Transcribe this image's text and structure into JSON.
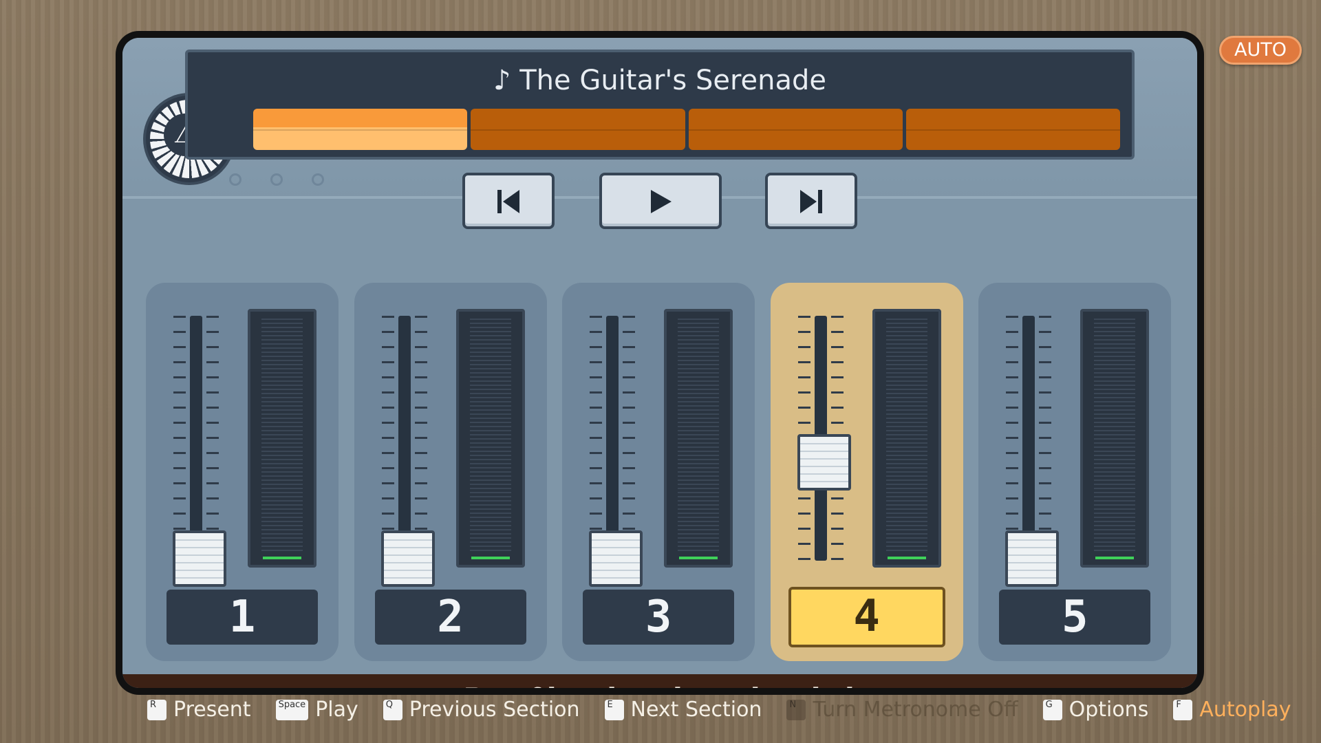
{
  "auto_badge": "AUTO",
  "song": {
    "title": "♪ The Guitar's Serenade",
    "sections_total": 4,
    "current_section": 1
  },
  "metronome": {
    "icon": "metronome-icon"
  },
  "transport": {
    "prev_icon": "skip-back-icon",
    "play_icon": "play-icon",
    "next_icon": "skip-forward-icon"
  },
  "channels": [
    {
      "number": "1",
      "fader_level": 0.0,
      "selected": false
    },
    {
      "number": "2",
      "fader_level": 0.0,
      "selected": false
    },
    {
      "number": "3",
      "fader_level": 0.0,
      "selected": false
    },
    {
      "number": "4",
      "fader_level": 0.45,
      "selected": true
    },
    {
      "number": "5",
      "fader_level": 0.0,
      "selected": false
    }
  ],
  "subtitle": "Proof he played one-handed",
  "hints": [
    {
      "key": "R",
      "label": "Present",
      "state": "normal"
    },
    {
      "key": "Space",
      "label": "Play",
      "state": "normal"
    },
    {
      "key": "Q",
      "label": "Previous Section",
      "state": "normal"
    },
    {
      "key": "E",
      "label": "Next Section",
      "state": "normal"
    },
    {
      "key": "N",
      "label": "Turn Metronome Off",
      "state": "disabled"
    },
    {
      "key": "G",
      "label": "Options",
      "state": "normal"
    },
    {
      "key": "F",
      "label": "Autoplay",
      "state": "accent"
    }
  ],
  "colors": {
    "accent_orange": "#f99a3a",
    "selected_channel": "#d9bd86",
    "selected_label": "#ffd760",
    "meter_green": "#3fd15a"
  }
}
